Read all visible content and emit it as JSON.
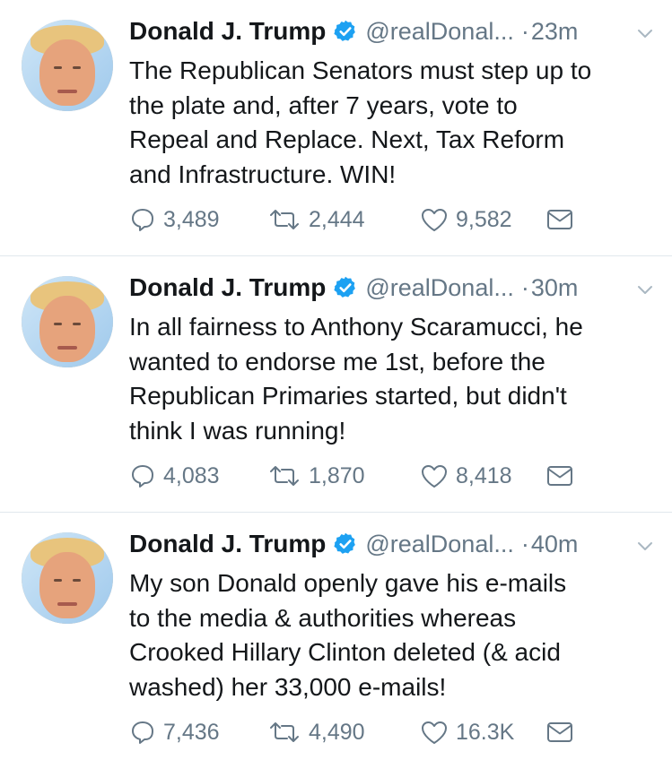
{
  "tweets": [
    {
      "name": "Donald J. Trump",
      "handle": "@realDonal...",
      "dot": "·",
      "time": "23m",
      "text": "The Republican Senators must step up to\nthe plate and, after 7 years, vote to\nRepeal and Replace. Next, Tax Reform\nand Infrastructure. WIN!",
      "replies": "3,489",
      "retweets": "2,444",
      "likes": "9,582"
    },
    {
      "name": "Donald J. Trump",
      "handle": "@realDonal...",
      "dot": "·",
      "time": "30m",
      "text": "In all fairness to Anthony Scaramucci, he\nwanted to endorse me 1st, before the\nRepublican Primaries started, but didn't\nthink I was running!",
      "replies": "4,083",
      "retweets": "1,870",
      "likes": "8,418"
    },
    {
      "name": "Donald J. Trump",
      "handle": "@realDonal...",
      "dot": "·",
      "time": "40m",
      "text": "My son Donald openly gave his e-mails\nto the media & authorities whereas\nCrooked Hillary Clinton deleted (& acid\nwashed) her 33,000 e-mails!",
      "replies": "7,436",
      "retweets": "4,490",
      "likes": "16.3K"
    }
  ],
  "icons": {
    "verified": "verified-badge-icon",
    "menu": "chevron-down-icon",
    "reply": "reply-icon",
    "retweet": "retweet-icon",
    "like": "heart-icon",
    "dm": "envelope-icon"
  },
  "colors": {
    "text": "#14171a",
    "secondary": "#657786",
    "verified": "#1da1f2",
    "divider": "#e1e8ed"
  }
}
